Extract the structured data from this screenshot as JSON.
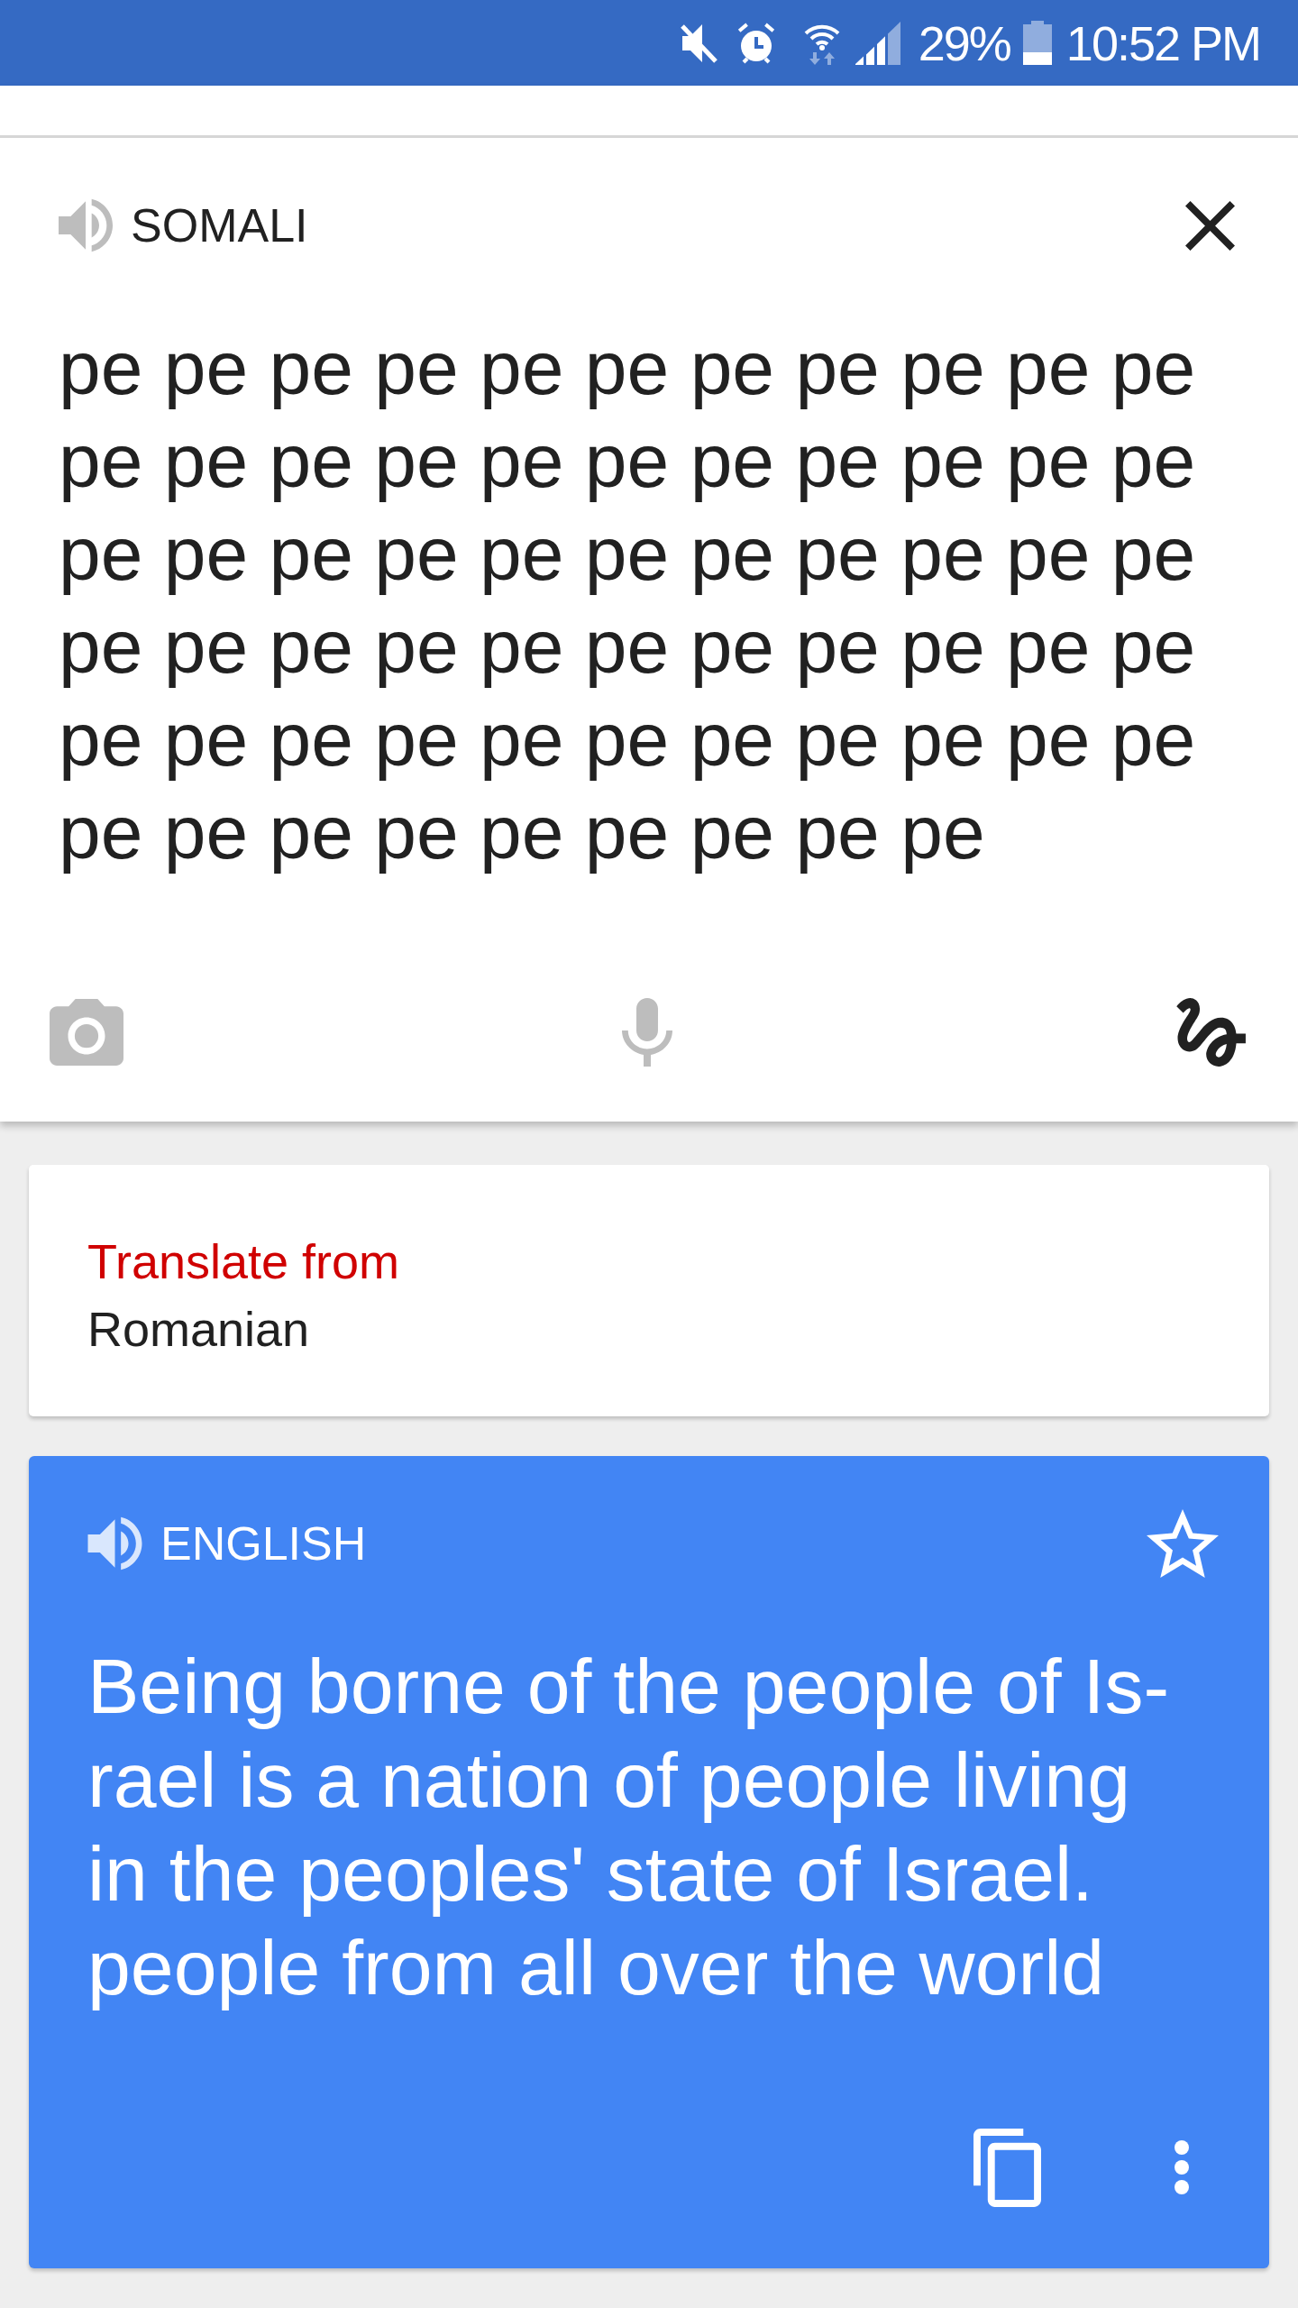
{
  "status_bar": {
    "battery_percent": "29%",
    "time": "10:52 PM"
  },
  "source": {
    "language": "SOMALI",
    "text": "pe pe pe pe pe pe pe pe pe pe pe pe pe pe pe pe pe pe pe pe pe pe pe pe pe pe pe pe pe pe pe pe pe pe pe pe pe pe pe pe pe pe pe pe pe pe pe pe pe pe pe pe pe pe pe pe pe pe pe pe pe pe pe pe"
  },
  "detected_language": {
    "label": "Translate from",
    "language": "Romanian"
  },
  "translation": {
    "language": "ENGLISH",
    "starred": false,
    "text": "Being borne of the people of Is-\nrael is a nation of people living\nin the peoples' state of Israel.\npeople from all over the world"
  }
}
